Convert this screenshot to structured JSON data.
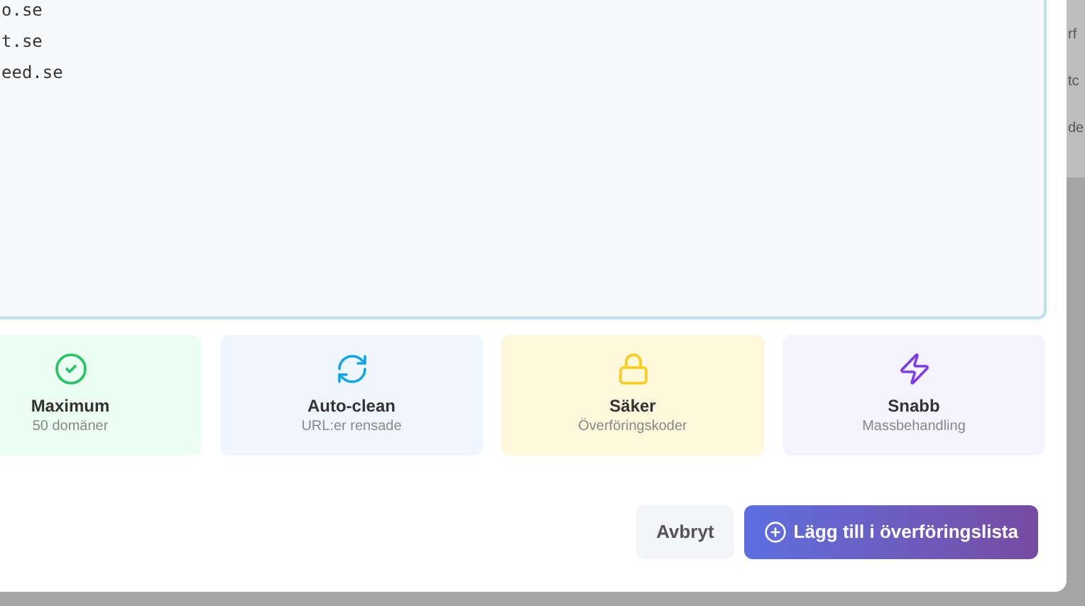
{
  "domain_input": {
    "lines": [
      "o.se",
      "t.se",
      "eed.se"
    ]
  },
  "features": [
    {
      "kind": "check",
      "title": "Maximum",
      "subtitle": "50 domäner",
      "color": "#ecfdf3"
    },
    {
      "kind": "refresh",
      "title": "Auto-clean",
      "subtitle": "URL:er rensade",
      "color": "#eff6ff"
    },
    {
      "kind": "lock",
      "title": "Säker",
      "subtitle": "Överföringskoder",
      "color": "#fef7dc"
    },
    {
      "kind": "bolt",
      "title": "Snabb",
      "subtitle": "Massbehandling",
      "color": "#f5f3ff"
    }
  ],
  "buttons": {
    "cancel": "Avbryt",
    "submit": "Lägg till i överföringslista"
  },
  "background_page": {
    "lines": [
      "rf",
      "tc",
      "de"
    ]
  }
}
